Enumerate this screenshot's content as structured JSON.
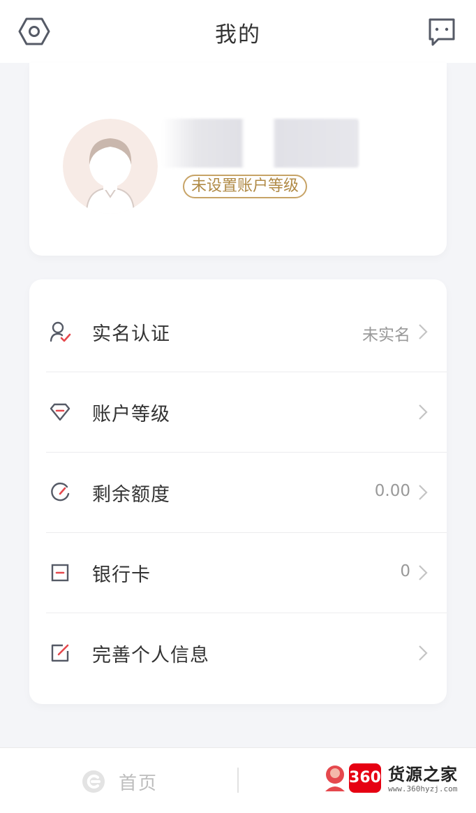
{
  "header": {
    "title": "我的"
  },
  "profile": {
    "level_badge": "未设置账户等级"
  },
  "menu": [
    {
      "icon": "user-check-icon",
      "label": "实名认证",
      "value": "未实名"
    },
    {
      "icon": "diamond-icon",
      "label": "账户等级",
      "value": ""
    },
    {
      "icon": "gauge-icon",
      "label": "剩余额度",
      "value": "0.00"
    },
    {
      "icon": "bank-card-icon",
      "label": "银行卡",
      "value": "0"
    },
    {
      "icon": "edit-icon",
      "label": "完善个人信息",
      "value": ""
    }
  ],
  "tabbar": {
    "home_label": "首页"
  },
  "watermark": {
    "logo": "360",
    "title": "货源之家",
    "url": "www.360hyzj.com"
  },
  "colors": {
    "accent": "#e5484d",
    "gold": "#c7a366",
    "icon_gray": "#555a66"
  }
}
